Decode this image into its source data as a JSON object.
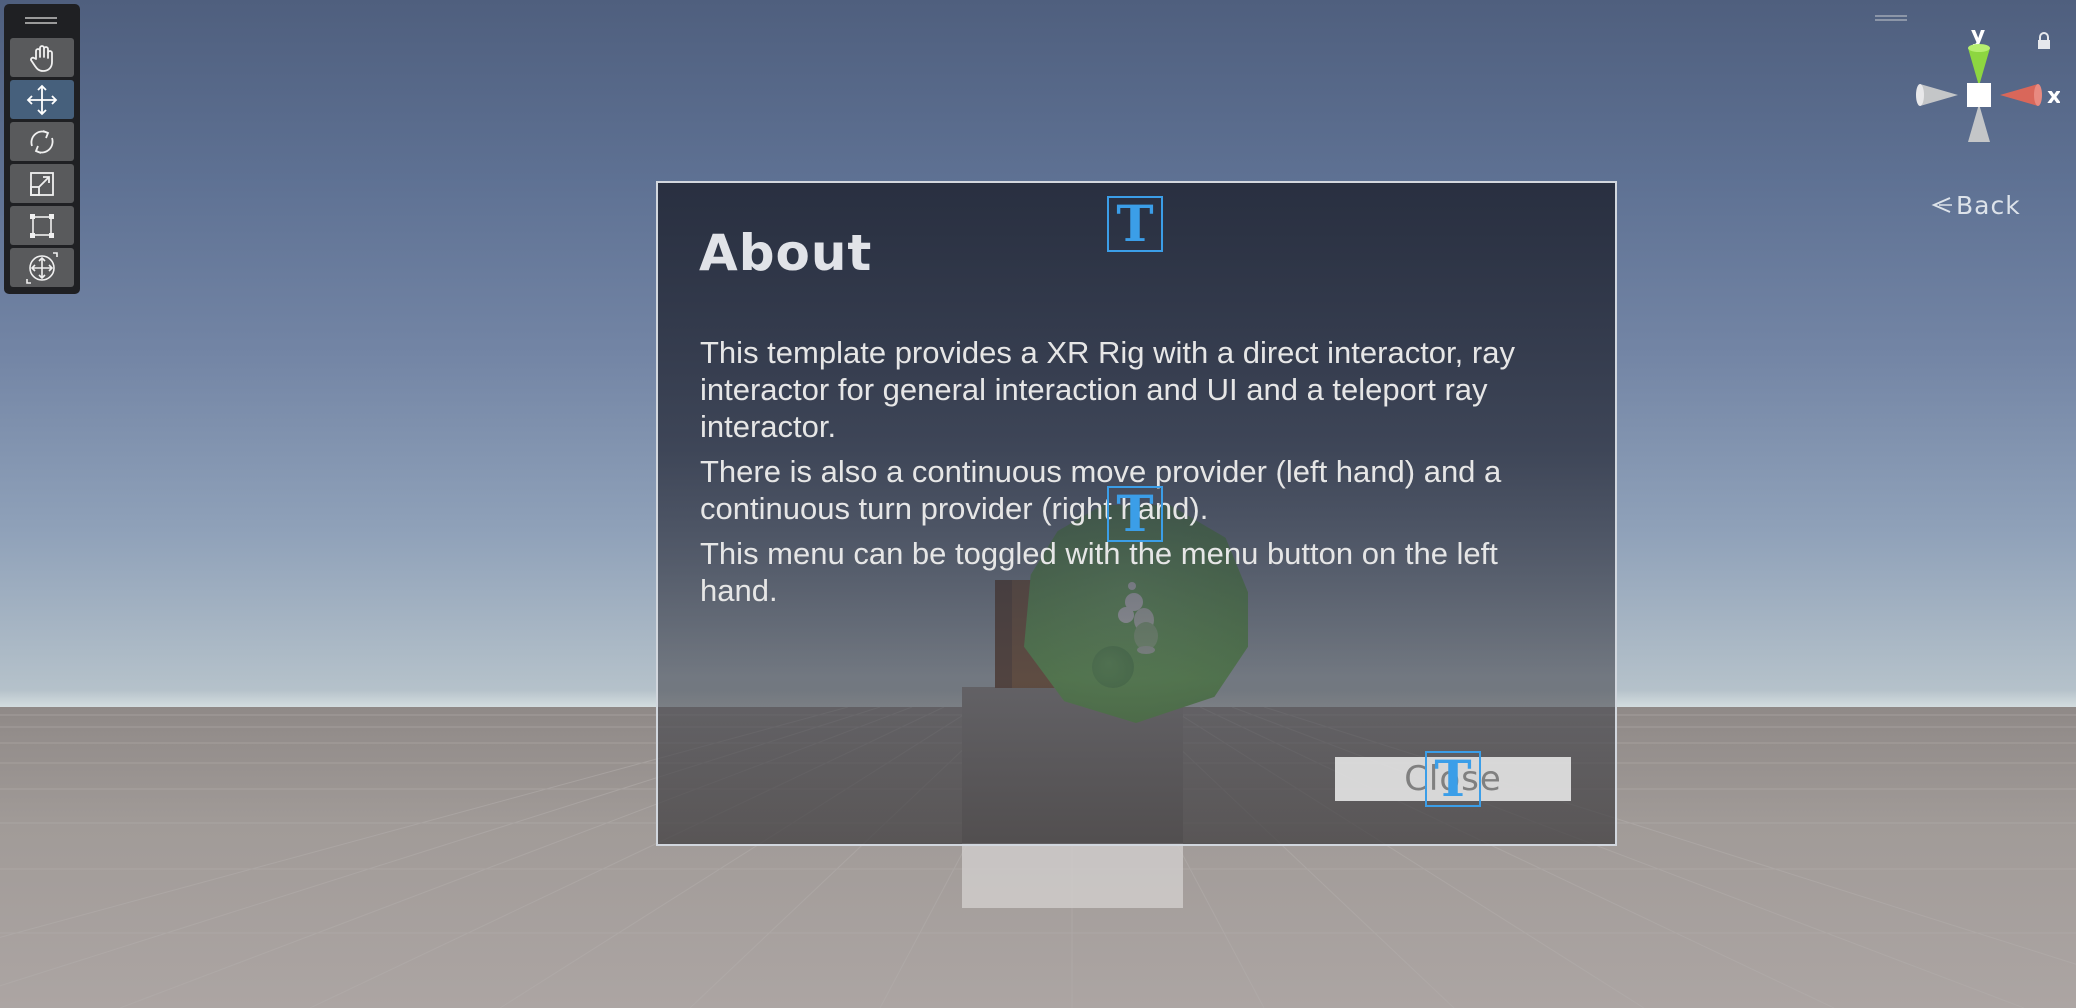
{
  "scene": {
    "sky_color": "#6a7c9d",
    "ground_color": "#a19b98",
    "sphere_color": "#5db244"
  },
  "toolbar": {
    "tools": [
      {
        "name": "hand-tool",
        "icon": "hand-icon"
      },
      {
        "name": "move-tool",
        "icon": "move-arrows-icon",
        "active": true
      },
      {
        "name": "rotate-tool",
        "icon": "rotate-icon"
      },
      {
        "name": "scale-tool",
        "icon": "scale-icon"
      },
      {
        "name": "rect-tool",
        "icon": "rect-transform-icon"
      },
      {
        "name": "transform-tool",
        "icon": "transform-icon"
      }
    ]
  },
  "gizmo": {
    "y_label": "y",
    "x_label": "x",
    "back_label": "Back",
    "y_color": "#8dd640",
    "x_color": "#d9675a"
  },
  "about": {
    "title": "About",
    "paragraphs": [
      "This template provides a XR Rig with a direct interactor, ray interactor for general interaction and UI and a teleport ray interactor.",
      "There is also a continuous move provider (left hand) and a continuous turn provider (right hand).",
      "This menu can be toggled with the menu button on the left hand."
    ],
    "close_label": "Close",
    "text_gizmo_glyph": "T",
    "accent_color": "#3b9ee8"
  }
}
